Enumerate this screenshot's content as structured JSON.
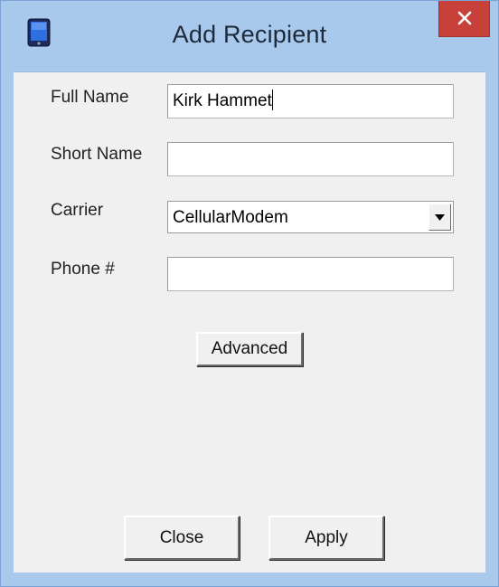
{
  "window": {
    "title": "Add Recipient",
    "icon": "phone-icon",
    "close_icon": "close-icon"
  },
  "form": {
    "full_name_label": "Full Name",
    "full_name_value": "Kirk Hammet",
    "short_name_label": "Short Name",
    "short_name_value": "",
    "carrier_label": "Carrier",
    "carrier_value": "CellularModem",
    "phone_label": "Phone #",
    "phone_value": ""
  },
  "buttons": {
    "advanced": "Advanced",
    "close": "Close",
    "apply": "Apply"
  },
  "colors": {
    "frame": "#a8c8ec",
    "close_button": "#c7403a",
    "client_background": "#f0f0f0"
  }
}
